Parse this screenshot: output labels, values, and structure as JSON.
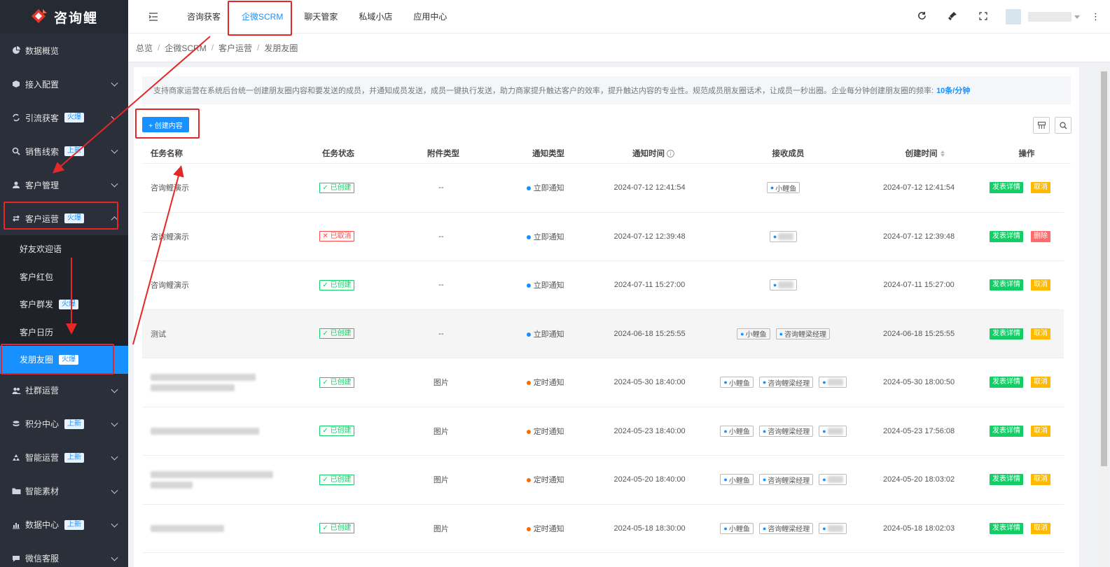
{
  "app": {
    "name": "咨询鲤"
  },
  "sidebar": {
    "items": [
      {
        "label": "数据概览",
        "icon": "pie-chart-icon",
        "badge": "",
        "chevron": false
      },
      {
        "label": "接入配置",
        "icon": "cube-icon",
        "badge": "",
        "chevron": true
      },
      {
        "label": "引流获客",
        "icon": "refresh-icon",
        "badge": "火爆",
        "chevron": true
      },
      {
        "label": "销售线索",
        "icon": "search-icon",
        "badge": "上新",
        "chevron": true
      },
      {
        "label": "客户管理",
        "icon": "user-icon",
        "badge": "",
        "chevron": true
      },
      {
        "label": "客户运营",
        "icon": "swap-icon",
        "badge": "火爆",
        "chevron": true,
        "expanded": true
      }
    ],
    "submenu": [
      {
        "label": "好友欢迎语",
        "badge": ""
      },
      {
        "label": "客户红包",
        "badge": ""
      },
      {
        "label": "客户群发",
        "badge": "火爆"
      },
      {
        "label": "客户日历",
        "badge": ""
      },
      {
        "label": "发朋友圈",
        "badge": "火爆",
        "active": true
      }
    ],
    "items_after": [
      {
        "label": "社群运营",
        "icon": "team-icon",
        "badge": ""
      },
      {
        "label": "积分中心",
        "icon": "coins-icon",
        "badge": "上新"
      },
      {
        "label": "智能运营",
        "icon": "recycle-icon",
        "badge": "上新"
      },
      {
        "label": "智能素材",
        "icon": "folder-icon",
        "badge": ""
      },
      {
        "label": "数据中心",
        "icon": "bar-chart-icon",
        "badge": "上新"
      },
      {
        "label": "微信客服",
        "icon": "chat-icon",
        "badge": ""
      }
    ]
  },
  "topbar": {
    "tabs": [
      {
        "label": "咨询获客",
        "active": false
      },
      {
        "label": "企微SCRM",
        "active": true
      },
      {
        "label": "聊天管家",
        "active": false
      },
      {
        "label": "私域小店",
        "active": false
      },
      {
        "label": "应用中心",
        "active": false
      }
    ]
  },
  "breadcrumb": [
    "总览",
    "企微SCRM",
    "客户运营",
    "发朋友圈"
  ],
  "notice": {
    "text": "支持商家运营在系统后台统一创建朋友圈内容和要发送的成员，并通知成员发送，成员一键执行发送，助力商家提升触达客户的效率，提升触达内容的专业性。规范成员朋友圈话术，让成员一秒出圈。企业每分钟创建朋友圈的频率:",
    "rate": "10条/分钟"
  },
  "create_button": "+ 创建内容",
  "table": {
    "headers": [
      "任务名称",
      "任务状态",
      "附件类型",
      "通知类型",
      "通知时间",
      "接收成员",
      "创建时间",
      "操作"
    ],
    "rows": [
      {
        "name": "咨询鲤演示",
        "status": "已创建",
        "status_type": "created",
        "attachment": "--",
        "notify": "立即通知",
        "notify_type": "instant",
        "notify_time": "2024-07-12 12:41:54",
        "members": [
          "小鲤鱼"
        ],
        "created": "2024-07-12 12:41:54",
        "ops": [
          "发表详情",
          "取消"
        ]
      },
      {
        "name": "咨询鲤演示",
        "status": "已取消",
        "status_type": "cancelled",
        "attachment": "--",
        "notify": "立即通知",
        "notify_type": "instant",
        "notify_time": "2024-07-12 12:39:48",
        "members": [
          ""
        ],
        "created": "2024-07-12 12:39:48",
        "ops": [
          "发表详情",
          "删除"
        ]
      },
      {
        "name": "咨询鲤演示",
        "status": "已创建",
        "status_type": "created",
        "attachment": "--",
        "notify": "立即通知",
        "notify_type": "instant",
        "notify_time": "2024-07-11 15:27:00",
        "members": [
          ""
        ],
        "created": "2024-07-11 15:27:00",
        "ops": [
          "发表详情",
          "取消"
        ]
      },
      {
        "name": "测试",
        "status": "已创建",
        "status_type": "created",
        "attachment": "--",
        "notify": "立即通知",
        "notify_type": "instant",
        "notify_time": "2024-06-18 15:25:55",
        "members": [
          "小鲤鱼",
          "咨询鲤梁经理"
        ],
        "created": "2024-06-18 15:25:55",
        "ops": [
          "发表详情",
          "取消"
        ]
      },
      {
        "name": "",
        "status": "已创建",
        "status_type": "created",
        "attachment": "图片",
        "notify": "定时通知",
        "notify_type": "timed",
        "notify_time": "2024-05-30 18:40:00",
        "members": [
          "小鲤鱼",
          "咨询鲤梁经理",
          ""
        ],
        "created": "2024-05-30 18:00:50",
        "ops": [
          "发表详情",
          "取消"
        ]
      },
      {
        "name": "",
        "status": "已创建",
        "status_type": "created",
        "attachment": "图片",
        "notify": "定时通知",
        "notify_type": "timed",
        "notify_time": "2024-05-23 18:40:00",
        "members": [
          "小鲤鱼",
          "咨询鲤梁经理",
          ""
        ],
        "created": "2024-05-23 17:56:08",
        "ops": [
          "发表详情",
          "取消"
        ]
      },
      {
        "name": "",
        "status": "已创建",
        "status_type": "created",
        "attachment": "图片",
        "notify": "定时通知",
        "notify_type": "timed",
        "notify_time": "2024-05-20 18:40:00",
        "members": [
          "小鲤鱼",
          "咨询鲤梁经理",
          ""
        ],
        "created": "2024-05-20 18:03:02",
        "ops": [
          "发表详情",
          "取消"
        ]
      },
      {
        "name": "",
        "status": "已创建",
        "status_type": "created",
        "attachment": "图片",
        "notify": "定时通知",
        "notify_type": "timed",
        "notify_time": "2024-05-18 18:30:00",
        "members": [
          "小鲤鱼",
          "咨询鲤梁经理",
          ""
        ],
        "created": "2024-05-18 18:02:03",
        "ops": [
          "发表详情",
          "取消"
        ]
      }
    ]
  },
  "colors": {
    "primary": "#1890ff",
    "success": "#13ce66",
    "warning": "#ffba00",
    "danger": "#ff6b6b",
    "sidebar_bg": "#2b2f3a",
    "annotation": "#e52727"
  }
}
